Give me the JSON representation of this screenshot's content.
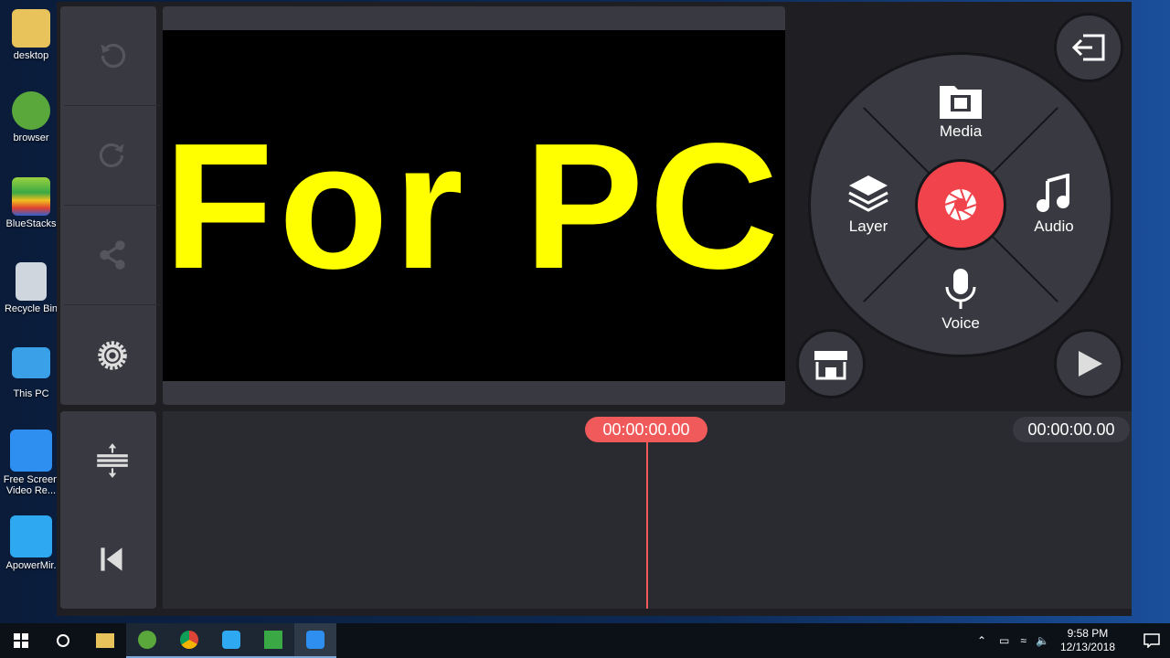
{
  "desktop_icons": [
    {
      "label": "desktop",
      "icon": "folder-icon",
      "color": "#e8c25a"
    },
    {
      "label": "browser",
      "icon": "browser-icon",
      "color": "#5aa83c"
    },
    {
      "label": "BlueStacks",
      "icon": "bluestacks-icon",
      "color": "#3aa844"
    },
    {
      "label": "Recycle Bin",
      "icon": "recycle-bin-icon",
      "color": "#cfd6de"
    },
    {
      "label": "This PC",
      "icon": "computer-icon",
      "color": "#3aa0e8"
    },
    {
      "label": "Free Screen Video Re...",
      "icon": "screen-recorder-icon",
      "color": "#2e8ff0"
    },
    {
      "label": "ApowerMir.",
      "icon": "apowermirror-icon",
      "color": "#2ea8f0"
    }
  ],
  "preview": {
    "overlay_text": "For PC",
    "overlay_color": "#ffff00"
  },
  "wheel": {
    "media": "Media",
    "layer": "Layer",
    "audio": "Audio",
    "voice": "Voice",
    "record_color": "#f0434b"
  },
  "timeline": {
    "playhead_time": "00:00:00.00",
    "total_time": "00:00:00.00",
    "accent": "#f05a5a"
  },
  "taskbar": {
    "time": "9:58 PM",
    "date": "12/13/2018"
  }
}
